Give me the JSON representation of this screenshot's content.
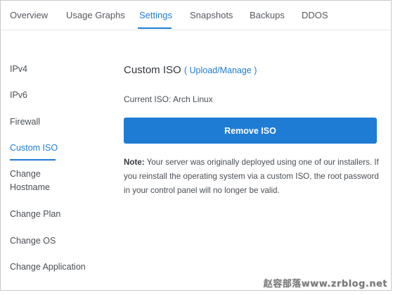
{
  "tabs": [
    {
      "label": "Overview",
      "active": false
    },
    {
      "label": "Usage Graphs",
      "active": false
    },
    {
      "label": "Settings",
      "active": true
    },
    {
      "label": "Snapshots",
      "active": false
    },
    {
      "label": "Backups",
      "active": false
    },
    {
      "label": "DDOS",
      "active": false
    }
  ],
  "sidebar": {
    "items": [
      {
        "label": "IPv4"
      },
      {
        "label": "IPv6"
      },
      {
        "label": "Firewall"
      },
      {
        "label": "Custom ISO",
        "active": true
      },
      {
        "label_line1": "Change",
        "label_line2": "Hostname"
      },
      {
        "label": "Change Plan"
      },
      {
        "label": "Change OS"
      },
      {
        "label": "Change Application"
      }
    ]
  },
  "main": {
    "title": "Custom ISO",
    "paren_open": "(",
    "upload_link": " Upload/Manage ",
    "paren_close": ")",
    "current_iso": "Current ISO: Arch Linux",
    "remove_button": "Remove ISO",
    "note_label": "Note:",
    "note_text": " Your server was originally deployed using one of our installers. If you reinstall the operating system via a custom ISO, the root password in your control panel will no longer be valid."
  },
  "watermark": "赵容部落www.zrblog.net",
  "colors": {
    "accent": "#1f7cd4",
    "text": "#4a4f55",
    "border": "#e3e6ea"
  }
}
